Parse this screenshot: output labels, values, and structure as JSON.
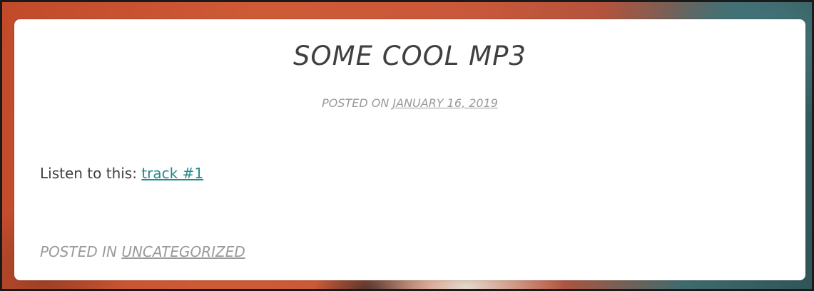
{
  "post": {
    "title": "SOME COOL MP3",
    "meta": {
      "prefix": "POSTED ON",
      "date": "JANUARY 16, 2019"
    },
    "content": {
      "text": "Listen to this:",
      "link_label": "track #1"
    },
    "footer": {
      "prefix": "POSTED IN",
      "category": "UNCATEGORIZED"
    }
  },
  "colors": {
    "link": "#238b8b",
    "muted": "#9a9a9a",
    "text": "#404040",
    "card": "#ffffff"
  }
}
